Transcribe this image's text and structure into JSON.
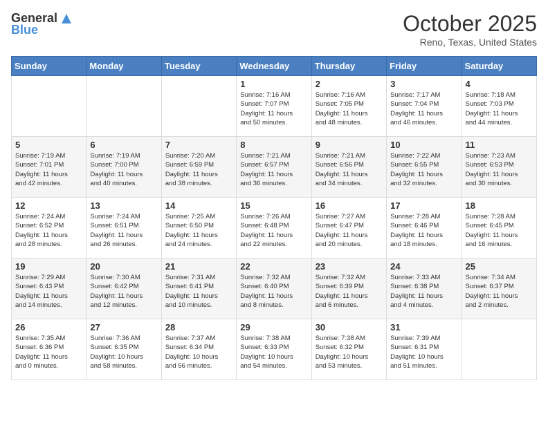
{
  "header": {
    "logo_general": "General",
    "logo_blue": "Blue",
    "month": "October 2025",
    "location": "Reno, Texas, United States"
  },
  "weekdays": [
    "Sunday",
    "Monday",
    "Tuesday",
    "Wednesday",
    "Thursday",
    "Friday",
    "Saturday"
  ],
  "weeks": [
    [
      {
        "day": "",
        "info": ""
      },
      {
        "day": "",
        "info": ""
      },
      {
        "day": "",
        "info": ""
      },
      {
        "day": "1",
        "info": "Sunrise: 7:16 AM\nSunset: 7:07 PM\nDaylight: 11 hours\nand 50 minutes."
      },
      {
        "day": "2",
        "info": "Sunrise: 7:16 AM\nSunset: 7:05 PM\nDaylight: 11 hours\nand 48 minutes."
      },
      {
        "day": "3",
        "info": "Sunrise: 7:17 AM\nSunset: 7:04 PM\nDaylight: 11 hours\nand 46 minutes."
      },
      {
        "day": "4",
        "info": "Sunrise: 7:18 AM\nSunset: 7:03 PM\nDaylight: 11 hours\nand 44 minutes."
      }
    ],
    [
      {
        "day": "5",
        "info": "Sunrise: 7:19 AM\nSunset: 7:01 PM\nDaylight: 11 hours\nand 42 minutes."
      },
      {
        "day": "6",
        "info": "Sunrise: 7:19 AM\nSunset: 7:00 PM\nDaylight: 11 hours\nand 40 minutes."
      },
      {
        "day": "7",
        "info": "Sunrise: 7:20 AM\nSunset: 6:59 PM\nDaylight: 11 hours\nand 38 minutes."
      },
      {
        "day": "8",
        "info": "Sunrise: 7:21 AM\nSunset: 6:57 PM\nDaylight: 11 hours\nand 36 minutes."
      },
      {
        "day": "9",
        "info": "Sunrise: 7:21 AM\nSunset: 6:56 PM\nDaylight: 11 hours\nand 34 minutes."
      },
      {
        "day": "10",
        "info": "Sunrise: 7:22 AM\nSunset: 6:55 PM\nDaylight: 11 hours\nand 32 minutes."
      },
      {
        "day": "11",
        "info": "Sunrise: 7:23 AM\nSunset: 6:53 PM\nDaylight: 11 hours\nand 30 minutes."
      }
    ],
    [
      {
        "day": "12",
        "info": "Sunrise: 7:24 AM\nSunset: 6:52 PM\nDaylight: 11 hours\nand 28 minutes."
      },
      {
        "day": "13",
        "info": "Sunrise: 7:24 AM\nSunset: 6:51 PM\nDaylight: 11 hours\nand 26 minutes."
      },
      {
        "day": "14",
        "info": "Sunrise: 7:25 AM\nSunset: 6:50 PM\nDaylight: 11 hours\nand 24 minutes."
      },
      {
        "day": "15",
        "info": "Sunrise: 7:26 AM\nSunset: 6:48 PM\nDaylight: 11 hours\nand 22 minutes."
      },
      {
        "day": "16",
        "info": "Sunrise: 7:27 AM\nSunset: 6:47 PM\nDaylight: 11 hours\nand 20 minutes."
      },
      {
        "day": "17",
        "info": "Sunrise: 7:28 AM\nSunset: 6:46 PM\nDaylight: 11 hours\nand 18 minutes."
      },
      {
        "day": "18",
        "info": "Sunrise: 7:28 AM\nSunset: 6:45 PM\nDaylight: 11 hours\nand 16 minutes."
      }
    ],
    [
      {
        "day": "19",
        "info": "Sunrise: 7:29 AM\nSunset: 6:43 PM\nDaylight: 11 hours\nand 14 minutes."
      },
      {
        "day": "20",
        "info": "Sunrise: 7:30 AM\nSunset: 6:42 PM\nDaylight: 11 hours\nand 12 minutes."
      },
      {
        "day": "21",
        "info": "Sunrise: 7:31 AM\nSunset: 6:41 PM\nDaylight: 11 hours\nand 10 minutes."
      },
      {
        "day": "22",
        "info": "Sunrise: 7:32 AM\nSunset: 6:40 PM\nDaylight: 11 hours\nand 8 minutes."
      },
      {
        "day": "23",
        "info": "Sunrise: 7:32 AM\nSunset: 6:39 PM\nDaylight: 11 hours\nand 6 minutes."
      },
      {
        "day": "24",
        "info": "Sunrise: 7:33 AM\nSunset: 6:38 PM\nDaylight: 11 hours\nand 4 minutes."
      },
      {
        "day": "25",
        "info": "Sunrise: 7:34 AM\nSunset: 6:37 PM\nDaylight: 11 hours\nand 2 minutes."
      }
    ],
    [
      {
        "day": "26",
        "info": "Sunrise: 7:35 AM\nSunset: 6:36 PM\nDaylight: 11 hours\nand 0 minutes."
      },
      {
        "day": "27",
        "info": "Sunrise: 7:36 AM\nSunset: 6:35 PM\nDaylight: 10 hours\nand 58 minutes."
      },
      {
        "day": "28",
        "info": "Sunrise: 7:37 AM\nSunset: 6:34 PM\nDaylight: 10 hours\nand 56 minutes."
      },
      {
        "day": "29",
        "info": "Sunrise: 7:38 AM\nSunset: 6:33 PM\nDaylight: 10 hours\nand 54 minutes."
      },
      {
        "day": "30",
        "info": "Sunrise: 7:38 AM\nSunset: 6:32 PM\nDaylight: 10 hours\nand 53 minutes."
      },
      {
        "day": "31",
        "info": "Sunrise: 7:39 AM\nSunset: 6:31 PM\nDaylight: 10 hours\nand 51 minutes."
      },
      {
        "day": "",
        "info": ""
      }
    ]
  ]
}
